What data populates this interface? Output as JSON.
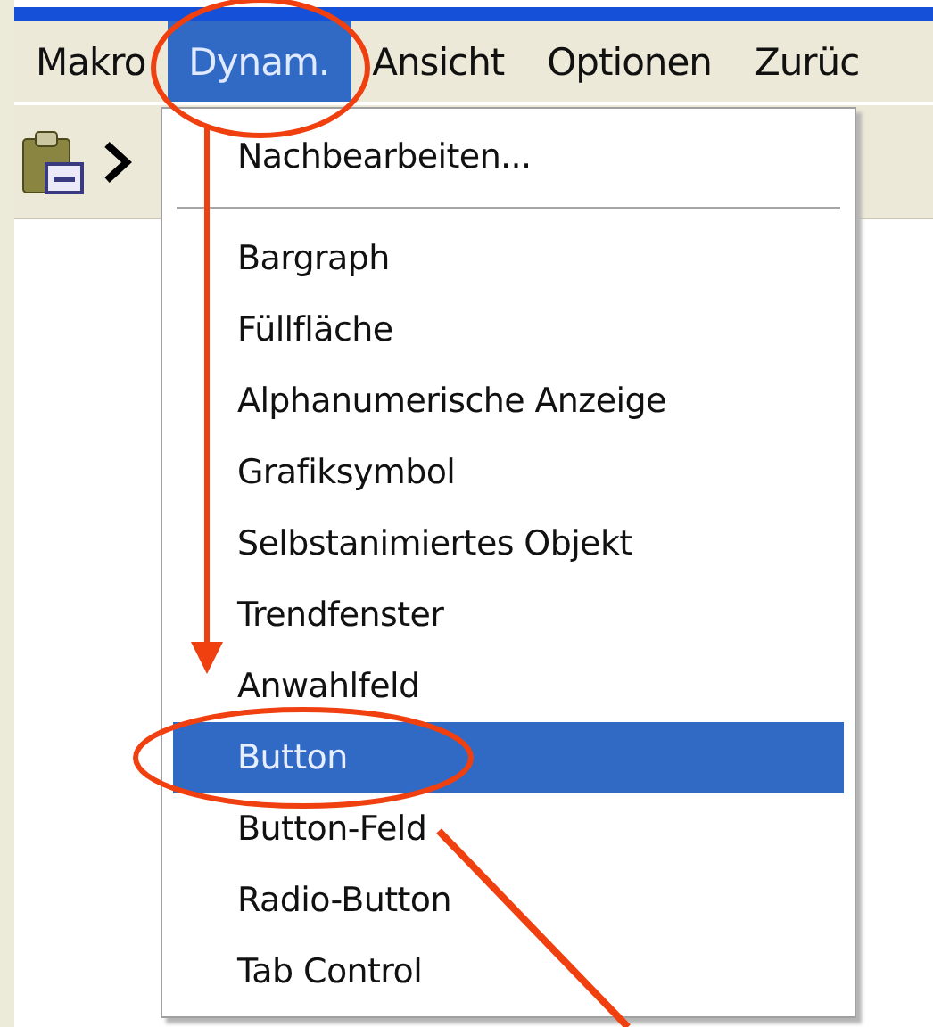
{
  "menubar": [
    {
      "label": "Makro",
      "selected": false
    },
    {
      "label": "Dynam.",
      "selected": true
    },
    {
      "label": "Ansicht",
      "selected": false
    },
    {
      "label": "Optionen",
      "selected": false
    },
    {
      "label": "Zurüc",
      "selected": false
    }
  ],
  "menu": [
    {
      "kind": "item",
      "label": "Nachbearbeiten...",
      "selected": false
    },
    {
      "kind": "separator"
    },
    {
      "kind": "item",
      "label": "Bargraph",
      "selected": false
    },
    {
      "kind": "item",
      "label": "Füllfläche",
      "selected": false
    },
    {
      "kind": "item",
      "label": "Alphanumerische Anzeige",
      "selected": false
    },
    {
      "kind": "item",
      "label": "Grafiksymbol",
      "selected": false
    },
    {
      "kind": "item",
      "label": "Selbstanimiertes Objekt",
      "selected": false
    },
    {
      "kind": "item",
      "label": "Trendfenster",
      "selected": false
    },
    {
      "kind": "item",
      "label": "Anwahlfeld",
      "selected": false
    },
    {
      "kind": "item",
      "label": "Button",
      "selected": true
    },
    {
      "kind": "item",
      "label": "Button-Feld",
      "selected": false
    },
    {
      "kind": "item",
      "label": "Radio-Button",
      "selected": false
    },
    {
      "kind": "item",
      "label": "Tab Control",
      "selected": false
    }
  ]
}
